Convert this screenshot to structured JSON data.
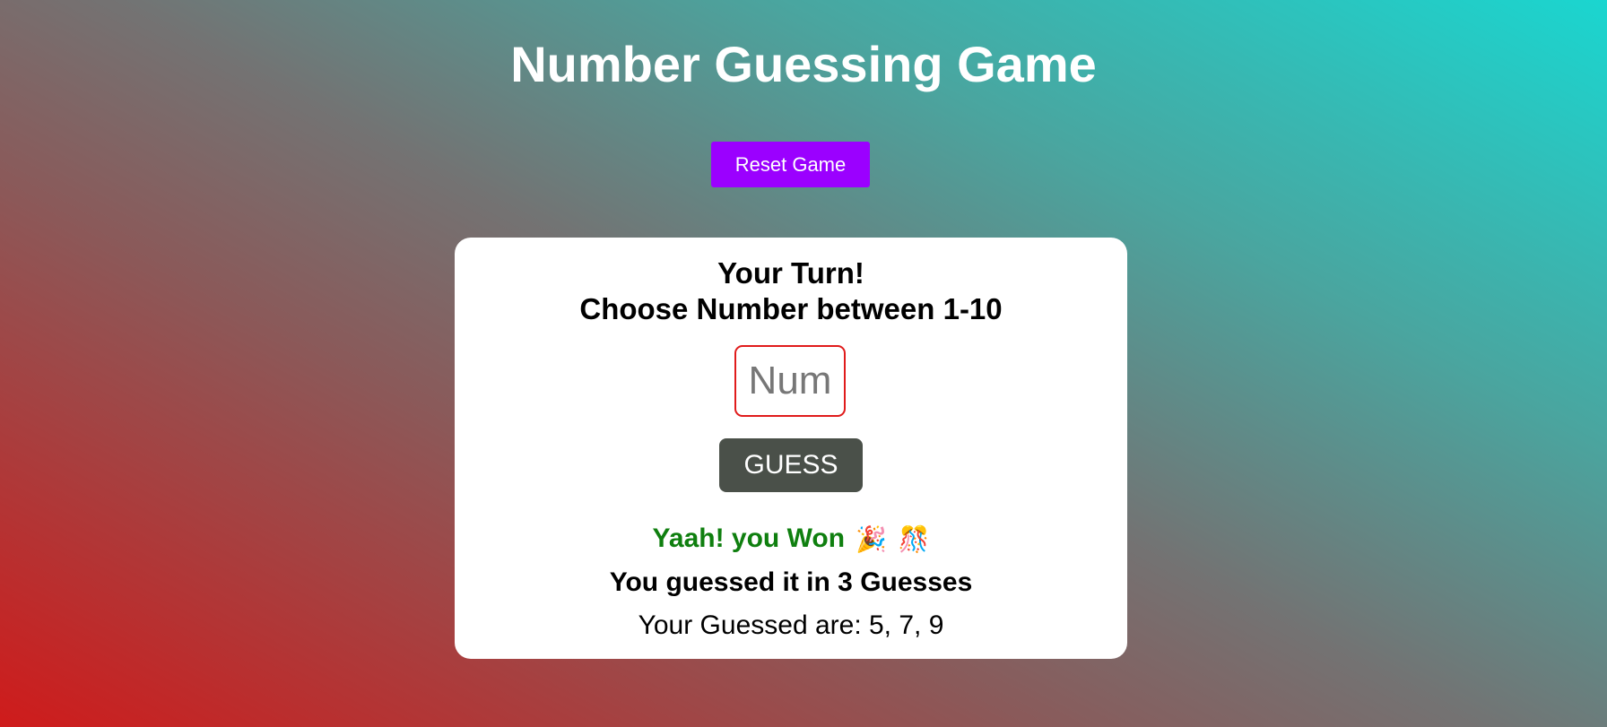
{
  "header": {
    "title": "Number Guessing Game"
  },
  "controls": {
    "reset_label": "Reset Game",
    "reset_color": "#9b00ff"
  },
  "card": {
    "turn_heading": "Your Turn!",
    "instruction": "Choose Number between 1-10",
    "input_placeholder": "Num",
    "input_value": "",
    "input_border_color": "#e01b1b",
    "guess_label": "GUESS",
    "guess_color": "#4a5049",
    "result_message": "Yaah! you Won",
    "result_color": "#0f7f0f",
    "result_icons": [
      "party-popper-icon",
      "confetti-ball-icon"
    ],
    "summary_text": "You guessed it in 3 Guesses",
    "guesses_text": "Your Guessed are: 5, 7, 9"
  }
}
